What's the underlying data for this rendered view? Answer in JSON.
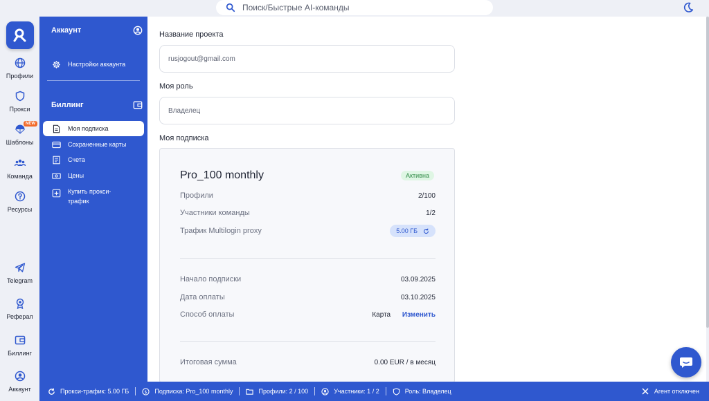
{
  "search": {
    "placeholder": "Поиск/Быстрые AI-команды"
  },
  "rail": {
    "items": [
      {
        "label": "Профили",
        "icon": "globe-icon"
      },
      {
        "label": "Прокси",
        "icon": "shield-icon"
      },
      {
        "label": "Шаблоны",
        "icon": "parachute-icon",
        "badge": "NEW"
      },
      {
        "label": "Команда",
        "icon": "team-icon"
      },
      {
        "label": "Ресурсы",
        "icon": "help-icon"
      },
      {
        "label": "Telegram",
        "icon": "telegram-icon"
      },
      {
        "label": "Реферал",
        "icon": "referral-icon"
      },
      {
        "label": "Биллинг",
        "icon": "wallet-icon"
      },
      {
        "label": "Аккаунт",
        "icon": "account-icon"
      }
    ]
  },
  "sidebar": {
    "account_heading": "Аккаунт",
    "account_settings": "Настройки аккаунта",
    "billing_heading": "Биллинг",
    "billing_items": [
      {
        "label": "Моя подписка",
        "active": true
      },
      {
        "label": "Сохраненные карты"
      },
      {
        "label": "Счета"
      },
      {
        "label": "Цены"
      },
      {
        "label": "Купить прокси-трафик"
      }
    ]
  },
  "form": {
    "project_label": "Название проекта",
    "project_value": "rusjogout@gmail.com",
    "role_label": "Моя роль",
    "role_value": "Владелец",
    "subscription_label": "Моя подписка"
  },
  "subscription": {
    "plan": "Pro_100 monthly",
    "status": "Активна",
    "profiles_label": "Профили",
    "profiles_value": "2/100",
    "members_label": "Участники команды",
    "members_value": "1/2",
    "traffic_label": "Трафик Multilogin proxy",
    "traffic_value": "5.00 ГБ",
    "start_label": "Начало подписки",
    "start_value": "03.09.2025",
    "payment_date_label": "Дата оплаты",
    "payment_date_value": "03.10.2025",
    "method_label": "Способ оплаты",
    "method_value": "Карта",
    "change_label": "Изменить",
    "total_label": "Итоговая сумма",
    "total_value": "0.00 EUR / в месяц"
  },
  "statusbar": {
    "proxy_traffic": "Прокси-трафик: 5.00 ГБ",
    "subscription": "Подписка: Pro_100 monthly",
    "profiles": "Профили: 2 / 100",
    "members": "Участники: 1 / 2",
    "role": "Роль: Владелец",
    "agent": "Агент отключен"
  },
  "colors": {
    "brand": "#2f58cf",
    "active_bg": "#dff6e4",
    "active_text": "#2f8a46",
    "badge": "#f26b2a"
  }
}
